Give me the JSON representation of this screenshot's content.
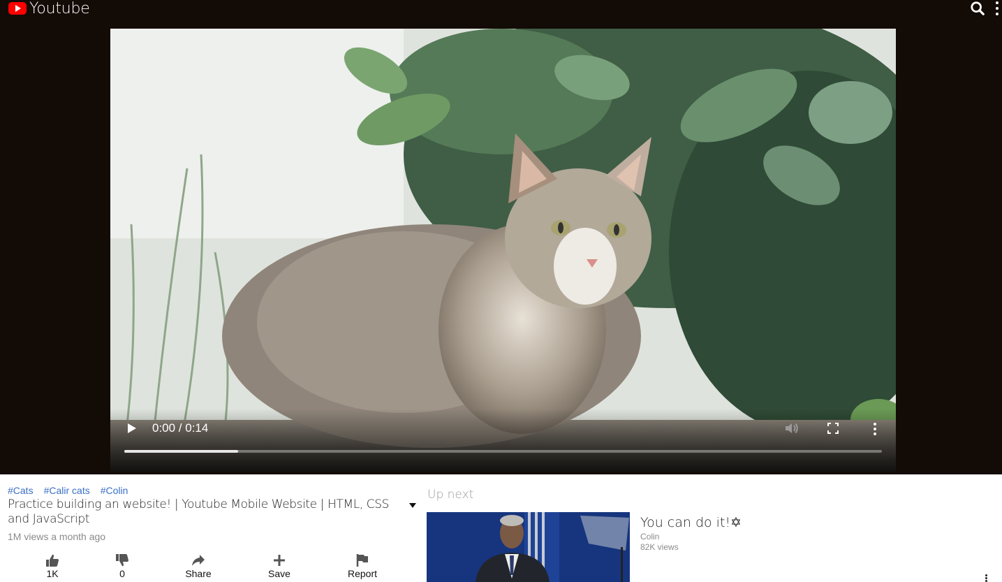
{
  "header": {
    "app_name": "Youtube",
    "icons": [
      "youtube-logo-icon",
      "search-icon",
      "more-vert-icon"
    ],
    "background": "#130b05",
    "logo_color": "#ff0000"
  },
  "player": {
    "time_display": "0:00 / 0:14",
    "progress_fraction": 0.15,
    "icons": [
      "play-icon",
      "volume-icon",
      "fullscreen-icon",
      "more-vert-icon"
    ]
  },
  "video": {
    "tags": [
      "#Cats",
      "#Calir cats",
      "#Colin"
    ],
    "title": "Practice building an website! | Youtube Mobile Website | HTML, CSS and JavaScript",
    "meta": "1M views a month ago",
    "tag_color": "#3a6fc7",
    "actions": [
      {
        "icon": "thumbs-up-icon",
        "label": "1K"
      },
      {
        "icon": "thumbs-down-icon",
        "label": "0"
      },
      {
        "icon": "share-icon",
        "label": "Share"
      },
      {
        "icon": "plus-icon",
        "label": "Save"
      },
      {
        "icon": "flag-icon",
        "label": "Report"
      }
    ]
  },
  "sidebar": {
    "heading": "Up next",
    "items": [
      {
        "title": "You can do it!✡",
        "channel": "Colin",
        "views": "82K views"
      }
    ]
  }
}
